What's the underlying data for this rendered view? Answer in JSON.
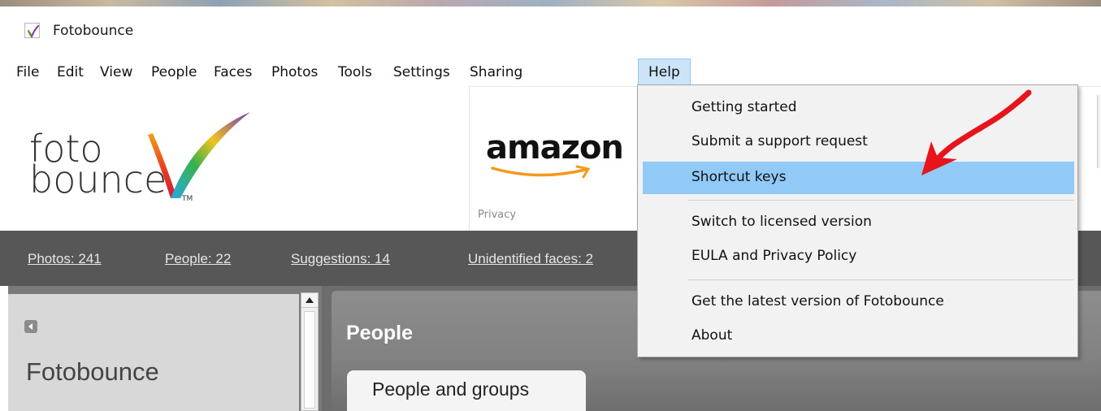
{
  "window": {
    "title": "Fotobounce"
  },
  "menubar": {
    "items": [
      {
        "label": "File"
      },
      {
        "label": "Edit"
      },
      {
        "label": "View"
      },
      {
        "label": "People"
      },
      {
        "label": "Faces"
      },
      {
        "label": "Photos"
      },
      {
        "label": "Tools"
      },
      {
        "label": "Settings"
      },
      {
        "label": "Sharing"
      },
      {
        "label": "Help",
        "active": true
      }
    ]
  },
  "logo": {
    "line1": "foto",
    "line2": "bounce",
    "trademark": "TM"
  },
  "ad": {
    "brand": "amazon",
    "privacy_label": "Privacy"
  },
  "stats": {
    "photos": "Photos: 241",
    "people": "People: 22",
    "suggestions": "Suggestions: 14",
    "unidentified": "Unidentified faces: 2"
  },
  "sidebar": {
    "title": "Fotobounce"
  },
  "main": {
    "title": "People",
    "tabs": [
      {
        "label": "People and groups"
      }
    ]
  },
  "help_menu": {
    "items": [
      {
        "label": "Getting started"
      },
      {
        "label": "Submit a support request"
      },
      {
        "label": "Shortcut keys",
        "highlighted": true
      },
      {
        "label": "Switch to licensed version"
      },
      {
        "label": "EULA and Privacy Policy"
      },
      {
        "label": "Get the latest version of Fotobounce"
      },
      {
        "label": "About"
      }
    ]
  },
  "colors": {
    "menu_highlight": "#91c9f7",
    "stats_bar": "#575757",
    "annotation_arrow": "#e8141c"
  }
}
